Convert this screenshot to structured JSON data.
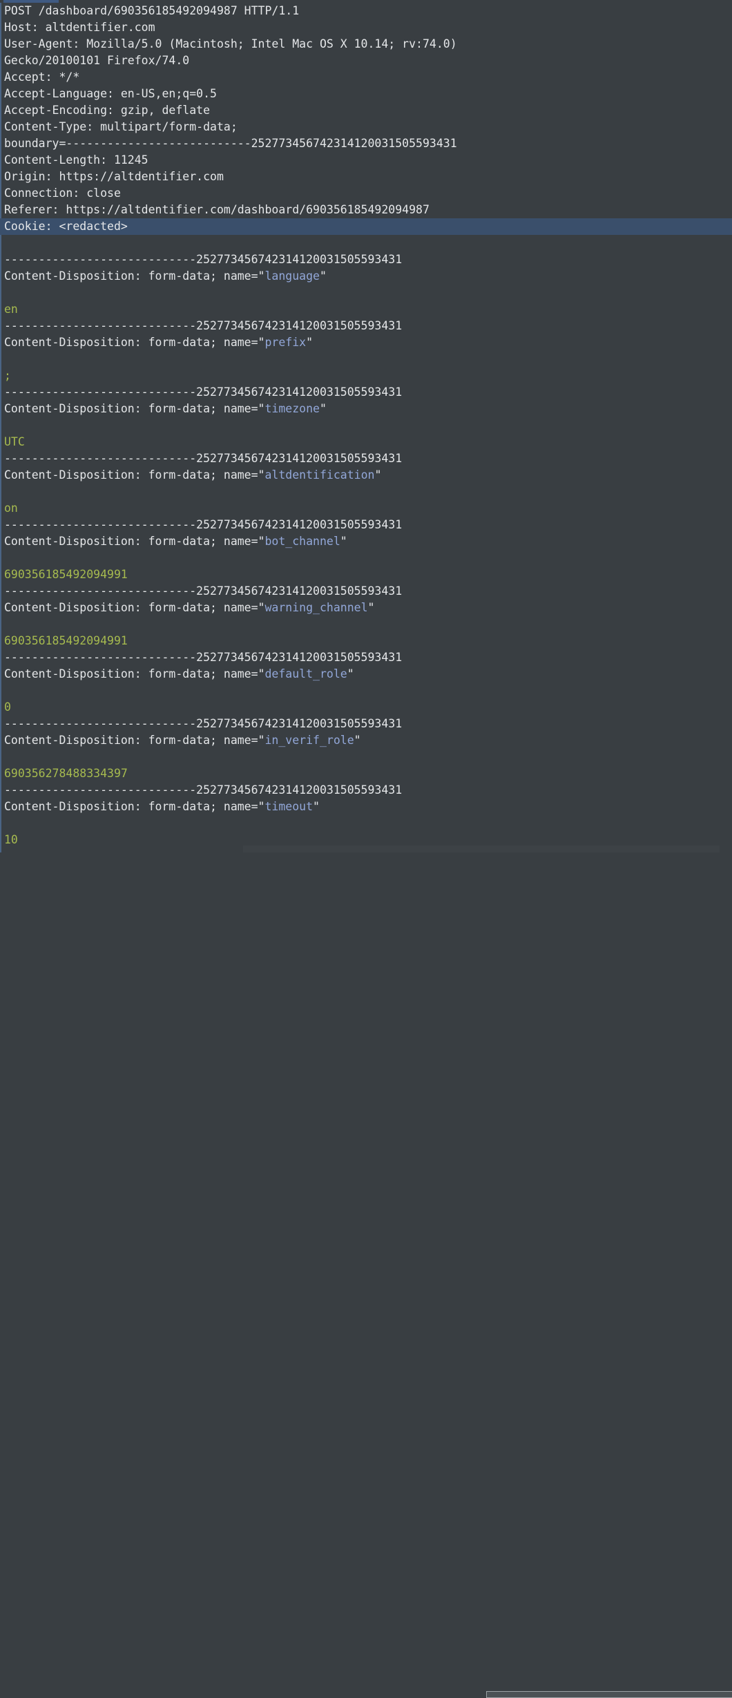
{
  "viewer": {
    "title": "http-request-raw-view",
    "colors": {
      "background": "#393e42",
      "text": "#e4e6e8",
      "selection": "#3a4f6b",
      "accent_tab": "#3f5a82",
      "param_name": "#92a7d8",
      "param_value": "#a6ba4f",
      "gutter": "#4a6485"
    }
  },
  "request": {
    "request_line": "POST /dashboard/690356185492094987 HTTP/1.1",
    "method": "POST",
    "path": "/dashboard/690356185492094987",
    "http_version": "HTTP/1.1",
    "headers": [
      {
        "name": "Host",
        "line": "Host: altdentifier.com"
      },
      {
        "name": "User-Agent",
        "line": "User-Agent: Mozilla/5.0 (Macintosh; Intel Mac OS X 10.14; rv:74.0)"
      },
      {
        "name": "User-Agent-cont",
        "line": "Gecko/20100101 Firefox/74.0"
      },
      {
        "name": "Accept",
        "line": "Accept: */*"
      },
      {
        "name": "Accept-Language",
        "line": "Accept-Language: en-US,en;q=0.5"
      },
      {
        "name": "Accept-Encoding",
        "line": "Accept-Encoding: gzip, deflate"
      },
      {
        "name": "Content-Type",
        "line": "Content-Type: multipart/form-data;"
      },
      {
        "name": "Content-Type-boundary",
        "line": "boundary=---------------------------252773456742314120031505593431"
      },
      {
        "name": "Content-Length",
        "line": "Content-Length: 11245"
      },
      {
        "name": "Origin",
        "line": "Origin: https://altdentifier.com"
      },
      {
        "name": "Connection",
        "line": "Connection: close"
      },
      {
        "name": "Referer",
        "line": "Referer: https://altdentifier.com/dashboard/690356185492094987"
      }
    ],
    "selected_header": {
      "name": "Cookie",
      "line": "Cookie: <redacted>"
    },
    "boundary_separator": "----------------------------252773456742314120031505593431",
    "disposition_prefix": "Content-Disposition: form-data; name=",
    "body_parts": [
      {
        "name": "language",
        "value": "en"
      },
      {
        "name": "prefix",
        "value": ";"
      },
      {
        "name": "timezone",
        "value": "UTC"
      },
      {
        "name": "altdentification",
        "value": "on"
      },
      {
        "name": "bot_channel",
        "value": "690356185492094991"
      },
      {
        "name": "warning_channel",
        "value": "690356185492094991"
      },
      {
        "name": "default_role",
        "value": "0"
      },
      {
        "name": "in_verif_role",
        "value": "690356278488334397"
      },
      {
        "name": "timeout",
        "value": "10"
      }
    ]
  },
  "scrollbar": {
    "orientation": "horizontal",
    "label": "horizontal-scrollbar"
  }
}
